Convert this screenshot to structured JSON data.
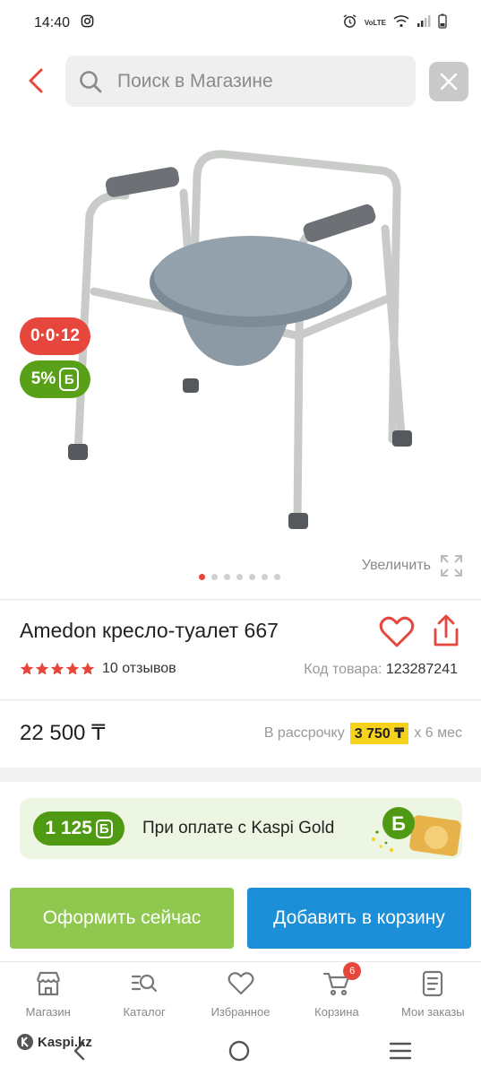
{
  "status_bar": {
    "time": "14:40",
    "network_label": "VoLTE"
  },
  "search": {
    "placeholder": "Поиск в Магазине"
  },
  "badges": {
    "installment": "0·0·12",
    "bonus_percent": "5%",
    "bonus_symbol": "Б"
  },
  "gallery": {
    "dot_count": 7,
    "active_index": 0,
    "zoom_label": "Увеличить"
  },
  "product": {
    "title": "Amedon кресло-туалет 667",
    "rating": 5,
    "reviews_label": "10 отзывов",
    "sku_label": "Код товара:",
    "sku_value": "123287241",
    "price": "22 500 ₸",
    "installment_prefix": "В рассрочку",
    "installment_amount": "3 750 ₸",
    "installment_suffix": "х 6 мес"
  },
  "kaspi_gold": {
    "bonus_amount": "1 125",
    "bonus_symbol": "Б",
    "text": "При оплате с Kaspi Gold"
  },
  "actions": {
    "buy_now": "Оформить сейчас",
    "add_to_cart": "Добавить в корзину"
  },
  "bottom_nav": [
    {
      "label": "Магазин",
      "icon": "store-icon"
    },
    {
      "label": "Каталог",
      "icon": "catalog-search-icon"
    },
    {
      "label": "Избранное",
      "icon": "heart-icon"
    },
    {
      "label": "Корзина",
      "icon": "cart-icon",
      "badge": "6"
    },
    {
      "label": "Мои заказы",
      "icon": "orders-icon"
    }
  ],
  "watermark": "Kaspi.kz",
  "colors": {
    "accent_red": "#e6463c",
    "bonus_green": "#57a017",
    "buy_green": "#8fc74f",
    "cart_blue": "#1d8fd8",
    "installment_yellow": "#f6d21d"
  }
}
